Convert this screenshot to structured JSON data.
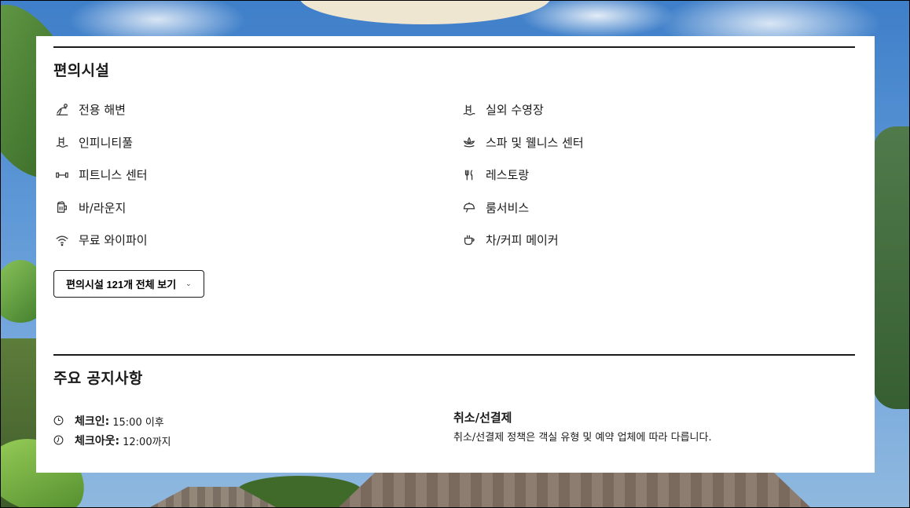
{
  "amenities_section": {
    "title": "편의시설",
    "items": [
      {
        "label": "전용 해변",
        "icon": "beach-icon"
      },
      {
        "label": "실외 수영장",
        "icon": "pool-icon"
      },
      {
        "label": "인피니티풀",
        "icon": "infinity-pool-icon"
      },
      {
        "label": "스파 및 웰니스 센터",
        "icon": "spa-icon"
      },
      {
        "label": "피트니스 센터",
        "icon": "dumbbell-icon"
      },
      {
        "label": "레스토랑",
        "icon": "restaurant-icon"
      },
      {
        "label": "바/라운지",
        "icon": "beer-mug-icon"
      },
      {
        "label": "룸서비스",
        "icon": "room-service-icon"
      },
      {
        "label": "무료 와이파이",
        "icon": "wifi-icon"
      },
      {
        "label": "차/커피 메이커",
        "icon": "coffee-cup-icon"
      }
    ],
    "show_all_label": "편의시설 121개 전체 보기"
  },
  "notices_section": {
    "title": "주요 공지사항",
    "checkin_label": "체크인:",
    "checkin_value": "15:00 이후",
    "checkout_label": "체크아웃:",
    "checkout_value": "12:00까지",
    "cancel_title": "취소/선결제",
    "cancel_text": "취소/선결제 정책은 객실 유형 및 예약 업체에 따라 다릅니다."
  }
}
